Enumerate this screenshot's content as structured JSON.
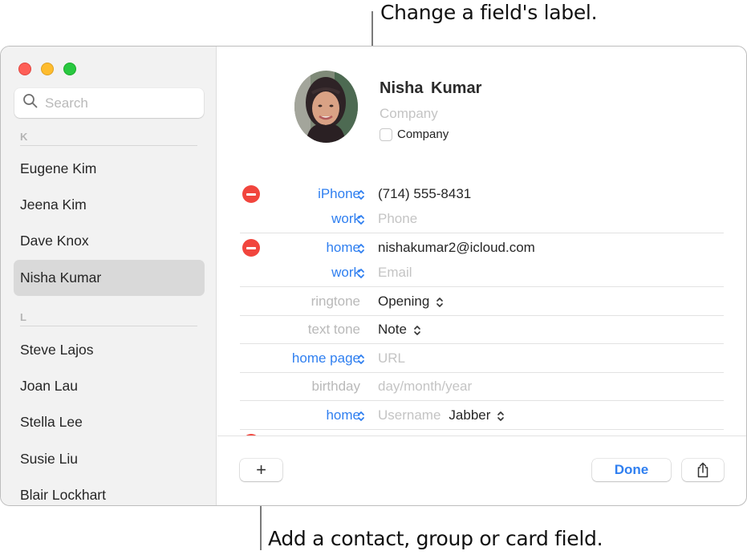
{
  "callouts": {
    "top": "Change a field's label.",
    "bottom": "Add a contact, group or card field."
  },
  "window": {
    "traffic_lights": [
      "close",
      "minimize",
      "zoom"
    ]
  },
  "sidebar": {
    "search": {
      "placeholder": "Search",
      "value": ""
    },
    "sections": [
      {
        "header": "K",
        "contacts": [
          "Eugene Kim",
          "Jeena Kim",
          "Dave Knox",
          "Nisha Kumar"
        ]
      },
      {
        "header": "L",
        "contacts": [
          "Steve Lajos",
          "Joan Lau",
          "Stella Lee",
          "Susie Liu",
          "Blair Lockhart"
        ]
      }
    ],
    "selected_contact": "Nisha Kumar"
  },
  "card": {
    "name": "Nisha  Kumar",
    "company_placeholder": "Company",
    "company_checkbox_label": "Company",
    "company_checked": false,
    "fields": [
      {
        "label": "iPhone",
        "value": "(714) 555-8431",
        "placeholder": false,
        "removable": true,
        "label_editable": true
      },
      {
        "label": "work",
        "value": "Phone",
        "placeholder": true,
        "removable": false,
        "label_editable": true
      },
      {
        "label": "home",
        "value": "nishakumar2@icloud.com",
        "placeholder": false,
        "removable": true,
        "label_editable": true
      },
      {
        "label": "work",
        "value": "Email",
        "placeholder": true,
        "removable": false,
        "label_editable": true
      },
      {
        "label": "ringtone",
        "value": "Opening",
        "placeholder": false,
        "removable": false,
        "label_editable": false,
        "value_popup": true
      },
      {
        "label": "text tone",
        "value": "Note",
        "placeholder": false,
        "removable": false,
        "label_editable": false,
        "value_popup": true
      },
      {
        "label": "home page",
        "value": "URL",
        "placeholder": true,
        "removable": false,
        "label_editable": true
      },
      {
        "label": "birthday",
        "value": "day/month/year",
        "placeholder": true,
        "removable": false,
        "label_editable": false
      },
      {
        "label": "home",
        "value": "Username",
        "placeholder": true,
        "removable": false,
        "label_editable": true,
        "service": "Jabber"
      }
    ]
  },
  "footer": {
    "add_label": "+",
    "done_label": "Done",
    "share_icon": "share-icon"
  },
  "colors": {
    "accent": "#2f7ff0",
    "remove": "#f1453d",
    "selection": "#d9d9d9"
  }
}
